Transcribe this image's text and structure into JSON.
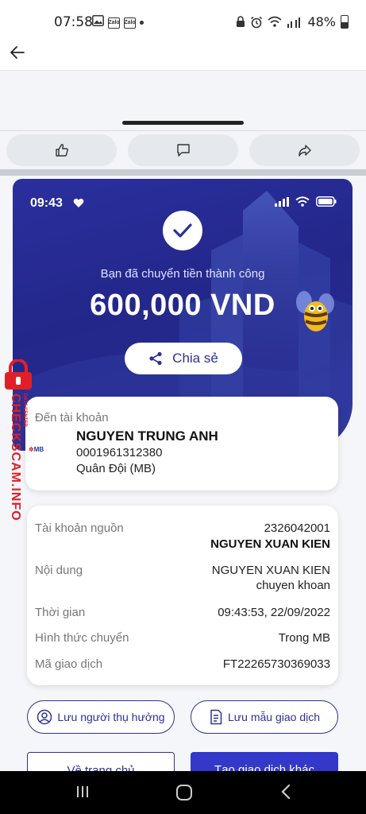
{
  "status_bar": {
    "time": "07:58",
    "notif_icons": [
      "image-icon",
      "zalo-icon",
      "zalo-icon"
    ],
    "zalo_label": "Zalo",
    "battery": "48%"
  },
  "post_actions": [
    "like-icon",
    "comment-icon",
    "share-icon"
  ],
  "receipt": {
    "inner_time": "09:43",
    "success_text": "Bạn đã chuyển tiền thành công",
    "amount": "600,000 VND",
    "share_label": "Chia sẻ",
    "recipient": {
      "label": "Đến tài khoản",
      "bank_logo": "MB",
      "name": "NGUYEN TRUNG ANH",
      "account": "0001961312380",
      "bank": "Quân Đội (MB)"
    },
    "details": {
      "source_label": "Tài khoản nguồn",
      "source_account": "2326042001",
      "source_name": "NGUYEN XUAN KIEN",
      "content_label": "Nội dung",
      "content_line1": "NGUYEN XUAN KIEN",
      "content_line2": "chuyen khoan",
      "time_label": "Thời gian",
      "time_value": "09:43:53, 22/09/2022",
      "method_label": "Hình thức chuyển",
      "method_value": "Trong MB",
      "code_label": "Mã giao dịch",
      "code_value": "FT22265730369033"
    },
    "save_beneficiary": "Lưu người thụ hưởng",
    "save_template": "Lưu mẫu giao dịch",
    "home_button": "Về trang chủ",
    "new_transaction_button": "Tạo giao dịch khác"
  },
  "watermark": {
    "main": "CHECKSCAM.INFO",
    "small": "DATA CENTER"
  },
  "colors": {
    "brand": "#2d3192",
    "hero_bg": "#252a8e",
    "watermark": "#e21f26"
  }
}
